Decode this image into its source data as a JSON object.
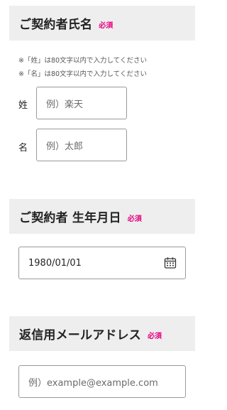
{
  "theme": {
    "required_color": "#e5007f",
    "header_bg": "#eeeeee"
  },
  "name_section": {
    "title": "ご契約者氏名",
    "required": "必須",
    "note_sei": "※「姓」は80文字以内で入力してください",
    "note_mei": "※「名」は80文字以内で入力してください",
    "sei_label": "姓",
    "sei_placeholder": "例）楽天",
    "mei_label": "名",
    "mei_placeholder": "例）太郎"
  },
  "birth_section": {
    "title": "ご契約者 生年月日",
    "required": "必須",
    "value": "1980/01/01",
    "icon": "calendar-icon"
  },
  "email_section": {
    "title": "返信用メールアドレス",
    "required": "必須",
    "placeholder": "例）example@example.com"
  }
}
